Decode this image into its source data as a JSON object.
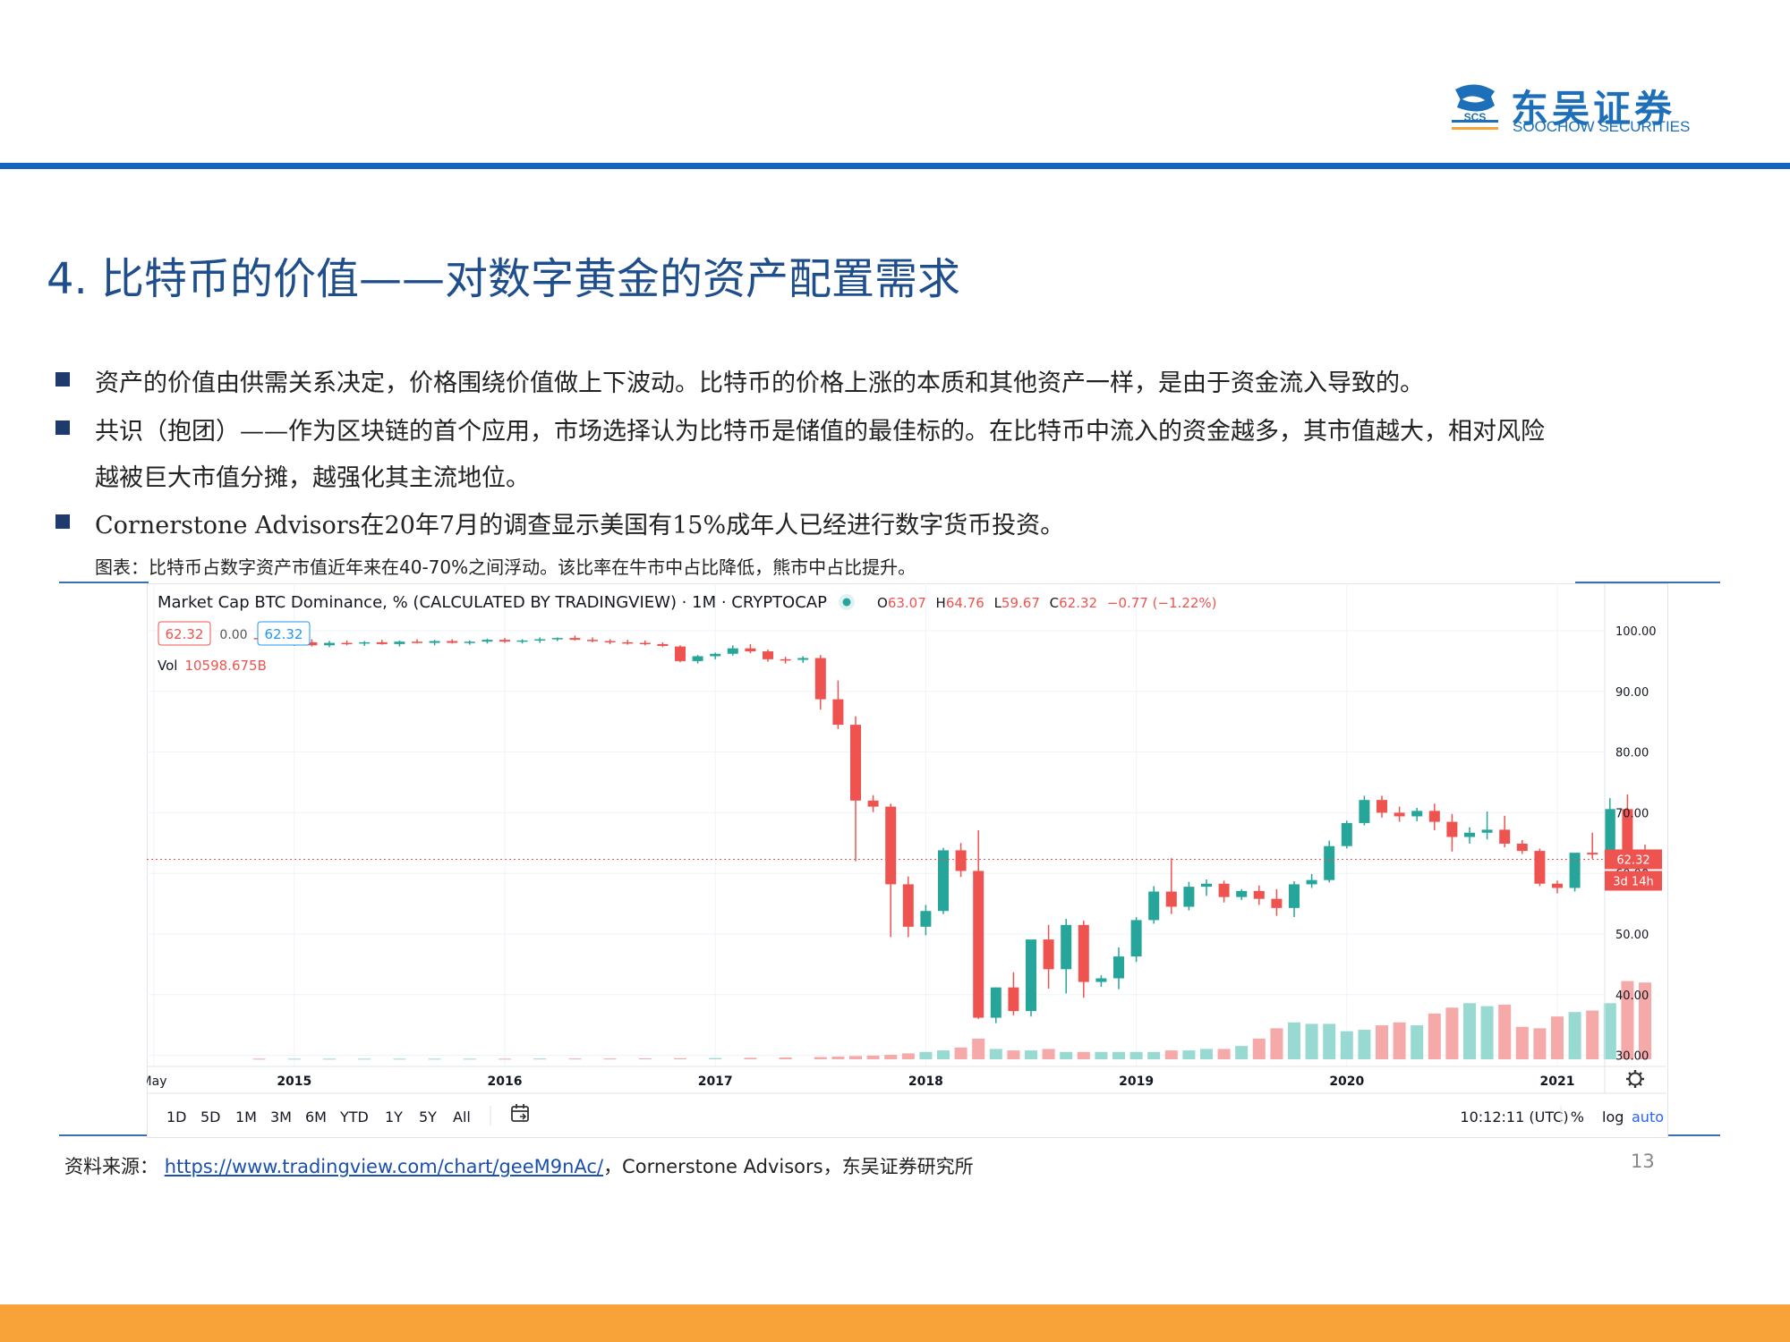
{
  "header": {
    "logo_cn": "东吴证券",
    "logo_en": "SOOCHOW SECURITIES",
    "logo_mark_text": "SCS",
    "brand_color": "#1c6fb8",
    "rule_color": "#1565c0"
  },
  "title": "4. 比特币的价值——对数字黄金的资产配置需求",
  "bullets": [
    "资产的价值由供需关系决定，价格围绕价值做上下波动。比特币的价格上涨的本质和其他资产一样，是由于资金流入导致的。",
    "共识（抱团）——作为区块链的首个应用，市场选择认为比特币是储值的最佳标的。在比特币中流入的资金越多，其市值越大，相对风险",
    "越被巨大市值分摊，越强化其主流地位。",
    "Cornerstone Advisors在20年7月的调查显示美国有15%成年人已经进行数字货币投资。"
  ],
  "caption": "图表：比特币占数字资产市值近年来在40-70%之间浮动。该比率在牛市中占比降低，熊市中占比提升。",
  "tv": {
    "header_title": "Market Cap BTC Dominance, % (CALCULATED BY TRADINGVIEW) · 1M · CRYPTOCAP",
    "ohlc": {
      "o_label": "O",
      "o": "63.07",
      "h_label": "H",
      "h": "64.76",
      "l_label": "L",
      "l": "59.67",
      "c_label": "C",
      "c": "62.32",
      "change": "−0.77 (−1.22%)"
    },
    "price_left": "62.32",
    "price_mid": "0.00",
    "price_right": "62.32",
    "vol_label": "Vol",
    "vol_value": "10598.675B",
    "last_price_label": "62.32",
    "countdown_label": "3d 14h",
    "ranges": [
      "1D",
      "5D",
      "1M",
      "3M",
      "6M",
      "YTD",
      "1Y",
      "5Y",
      "All"
    ],
    "time": "10:12:11 (UTC)",
    "right_buttons": [
      "%",
      "log",
      "auto"
    ],
    "settings_icon": "gear-icon",
    "compare_icon": "calendar-goto-icon",
    "colors": {
      "up": "#26a69a",
      "down": "#ef5350",
      "up_vol": "#98d9d2",
      "down_vol": "#f5a9a9",
      "accent": "#2962ff"
    }
  },
  "chart_data": {
    "type": "candlestick",
    "title": "Market Cap BTC Dominance, % (CALCULATED BY TRADINGVIEW)",
    "interval": "1M",
    "symbol": "CRYPTOCAP",
    "ylim": [
      28,
      102
    ],
    "yticks": [
      "100.00",
      "90.00",
      "80.00",
      "70.00",
      "60.00",
      "50.00",
      "40.00",
      "30.00"
    ],
    "yticks_values": [
      100,
      90,
      80,
      70,
      60,
      50,
      40,
      30
    ],
    "xticks": [
      {
        "label": "May",
        "month": 4
      },
      {
        "label": "2015",
        "month": 12
      },
      {
        "label": "2016",
        "month": 24
      },
      {
        "label": "2017",
        "month": 36
      },
      {
        "label": "2018",
        "month": 48
      },
      {
        "label": "2019",
        "month": 60
      },
      {
        "label": "2020",
        "month": 72
      },
      {
        "label": "2021",
        "month": 84
      }
    ],
    "month_start": "2014-01",
    "grid": true,
    "candles": [
      [
        10,
        98.8,
        99.2,
        98.5,
        98.6
      ],
      [
        11,
        98.6,
        98.9,
        97.6,
        97.9
      ],
      [
        12,
        97.9,
        98.4,
        97.5,
        98.1
      ],
      [
        13,
        98.1,
        98.6,
        97.4,
        97.6
      ],
      [
        14,
        97.6,
        98.3,
        97.3,
        98.0
      ],
      [
        15,
        98.0,
        98.4,
        97.6,
        97.9
      ],
      [
        16,
        97.9,
        98.3,
        97.5,
        98.1
      ],
      [
        17,
        98.1,
        98.5,
        97.7,
        97.8
      ],
      [
        18,
        97.8,
        98.4,
        97.4,
        98.2
      ],
      [
        19,
        98.2,
        98.6,
        97.9,
        98.0
      ],
      [
        20,
        98.0,
        98.5,
        97.6,
        98.3
      ],
      [
        21,
        98.3,
        98.6,
        97.9,
        98.0
      ],
      [
        22,
        98.0,
        98.4,
        97.7,
        98.2
      ],
      [
        23,
        98.2,
        98.7,
        97.9,
        98.5
      ],
      [
        24,
        98.5,
        98.8,
        98.0,
        98.2
      ],
      [
        25,
        98.2,
        98.6,
        97.9,
        98.4
      ],
      [
        26,
        98.4,
        98.9,
        98.0,
        98.6
      ],
      [
        27,
        98.6,
        98.9,
        98.3,
        98.8
      ],
      [
        28,
        98.8,
        99.2,
        98.4,
        98.5
      ],
      [
        29,
        98.5,
        98.9,
        98.1,
        98.3
      ],
      [
        30,
        98.3,
        98.6,
        97.8,
        98.1
      ],
      [
        31,
        98.1,
        98.5,
        97.7,
        98.0
      ],
      [
        32,
        98.0,
        98.4,
        97.6,
        97.8
      ],
      [
        33,
        97.8,
        98.1,
        97.3,
        97.5
      ],
      [
        34,
        97.4,
        97.6,
        94.8,
        95.0
      ],
      [
        35,
        95.0,
        96.0,
        94.6,
        95.8
      ],
      [
        36,
        95.8,
        96.4,
        95.3,
        96.2
      ],
      [
        37,
        96.2,
        97.6,
        95.9,
        97.1
      ],
      [
        38,
        97.1,
        97.8,
        96.3,
        96.6
      ],
      [
        39,
        96.6,
        96.9,
        94.9,
        95.3
      ],
      [
        40,
        95.3,
        95.7,
        94.6,
        95.2
      ],
      [
        41,
        95.2,
        95.8,
        94.7,
        95.5
      ],
      [
        42,
        95.5,
        96.0,
        87.0,
        88.7
      ],
      [
        43,
        88.7,
        91.8,
        83.8,
        84.5
      ],
      [
        44,
        84.5,
        85.9,
        62.0,
        72.0
      ],
      [
        45,
        72.0,
        72.9,
        70.1,
        71.0
      ],
      [
        46,
        71.0,
        71.5,
        49.5,
        58.2
      ],
      [
        47,
        58.2,
        59.5,
        49.5,
        51.2
      ],
      [
        48,
        51.2,
        54.8,
        49.8,
        53.8
      ],
      [
        49,
        53.8,
        64.2,
        53.3,
        63.8
      ],
      [
        50,
        63.8,
        65.0,
        59.4,
        60.4
      ],
      [
        51,
        60.4,
        67.1,
        36.0,
        36.2
      ],
      [
        52,
        36.2,
        41.2,
        35.3,
        41.2
      ],
      [
        53,
        41.2,
        43.7,
        36.6,
        37.3
      ],
      [
        54,
        37.3,
        44.2,
        36.4,
        49.1
      ],
      [
        55,
        49.1,
        51.5,
        41.0,
        44.2
      ],
      [
        56,
        44.2,
        52.5,
        40.2,
        51.5
      ],
      [
        57,
        51.5,
        52.2,
        39.5,
        42.1
      ],
      [
        58,
        42.1,
        43.2,
        41.3,
        42.7
      ],
      [
        59,
        42.7,
        47.8,
        40.9,
        46.3
      ],
      [
        60,
        46.3,
        52.8,
        45.4,
        52.3
      ],
      [
        61,
        52.3,
        57.9,
        51.7,
        57.0
      ],
      [
        62,
        57.0,
        62.5,
        53.3,
        54.5
      ],
      [
        63,
        54.5,
        58.6,
        53.9,
        57.8
      ],
      [
        64,
        57.8,
        59.0,
        56.3,
        58.3
      ],
      [
        65,
        58.3,
        58.8,
        55.2,
        56.1
      ],
      [
        66,
        56.1,
        57.4,
        55.6,
        57.1
      ],
      [
        67,
        57.1,
        58.0,
        54.8,
        55.8
      ],
      [
        68,
        55.8,
        57.4,
        53.0,
        54.3
      ],
      [
        69,
        54.3,
        58.7,
        52.8,
        58.2
      ],
      [
        70,
        58.2,
        59.9,
        57.6,
        58.9
      ],
      [
        71,
        58.9,
        65.4,
        58.5,
        64.5
      ],
      [
        72,
        64.5,
        68.7,
        64.1,
        68.3
      ],
      [
        73,
        68.3,
        72.8,
        67.9,
        72.1
      ],
      [
        74,
        72.1,
        72.8,
        69.2,
        70.0
      ],
      [
        75,
        70.0,
        71.0,
        68.5,
        69.4
      ],
      [
        76,
        69.4,
        70.8,
        68.6,
        70.3
      ],
      [
        77,
        70.3,
        71.5,
        67.1,
        68.5
      ],
      [
        78,
        68.5,
        69.8,
        63.6,
        66.0
      ],
      [
        79,
        66.0,
        67.6,
        64.9,
        66.7
      ],
      [
        80,
        66.7,
        70.2,
        65.6,
        67.2
      ],
      [
        81,
        67.2,
        69.5,
        64.3,
        64.9
      ],
      [
        82,
        64.9,
        65.5,
        63.2,
        63.7
      ],
      [
        83,
        63.7,
        64.1,
        57.9,
        58.3
      ],
      [
        84,
        58.3,
        58.8,
        56.7,
        57.6
      ],
      [
        85,
        57.6,
        61.5,
        57.0,
        63.4
      ],
      [
        86,
        63.4,
        66.7,
        62.4,
        63.1
      ],
      [
        87,
        63.1,
        72.4,
        62.6,
        70.6
      ],
      [
        88,
        70.6,
        73.0,
        62.1,
        63.07
      ],
      [
        89,
        63.07,
        64.76,
        59.67,
        62.32
      ]
    ],
    "volume_scale_max": 100,
    "volume": [
      [
        10,
        0.4
      ],
      [
        12,
        0.4
      ],
      [
        14,
        0.4
      ],
      [
        16,
        0.4
      ],
      [
        18,
        0.4
      ],
      [
        20,
        0.4
      ],
      [
        22,
        0.4
      ],
      [
        24,
        0.4
      ],
      [
        26,
        0.5
      ],
      [
        28,
        0.5
      ],
      [
        30,
        0.5
      ],
      [
        32,
        0.6
      ],
      [
        34,
        0.7
      ],
      [
        36,
        0.8
      ],
      [
        38,
        1
      ],
      [
        40,
        1.2
      ],
      [
        42,
        1.5
      ],
      [
        43,
        1.8
      ],
      [
        44,
        2.2
      ],
      [
        45,
        2.5
      ],
      [
        46,
        3
      ],
      [
        47,
        4
      ],
      [
        48,
        5
      ],
      [
        49,
        6
      ],
      [
        50,
        8
      ],
      [
        51,
        14
      ],
      [
        52,
        7
      ],
      [
        53,
        6
      ],
      [
        54,
        6
      ],
      [
        55,
        7
      ],
      [
        56,
        5
      ],
      [
        57,
        5
      ],
      [
        58,
        5
      ],
      [
        59,
        5
      ],
      [
        60,
        5
      ],
      [
        61,
        5
      ],
      [
        62,
        6
      ],
      [
        63,
        6
      ],
      [
        64,
        7
      ],
      [
        65,
        7
      ],
      [
        66,
        9
      ],
      [
        67,
        14
      ],
      [
        68,
        21
      ],
      [
        69,
        25
      ],
      [
        70,
        24
      ],
      [
        71,
        24
      ],
      [
        72,
        19
      ],
      [
        73,
        20
      ],
      [
        74,
        23
      ],
      [
        75,
        25
      ],
      [
        76,
        23
      ],
      [
        77,
        31
      ],
      [
        78,
        35
      ],
      [
        79,
        38
      ],
      [
        80,
        36
      ],
      [
        81,
        37
      ],
      [
        82,
        22
      ],
      [
        83,
        21
      ],
      [
        84,
        29
      ],
      [
        85,
        32
      ],
      [
        86,
        33
      ],
      [
        87,
        38
      ],
      [
        88,
        53
      ],
      [
        89,
        52
      ]
    ]
  },
  "source": {
    "label": "资料来源：",
    "link": "https://www.tradingview.com/chart/geeM9nAc/",
    "rest": "，Cornerstone Advisors，东吴证券研究所"
  },
  "page_number": "13",
  "footer_color": "#f7a33a"
}
